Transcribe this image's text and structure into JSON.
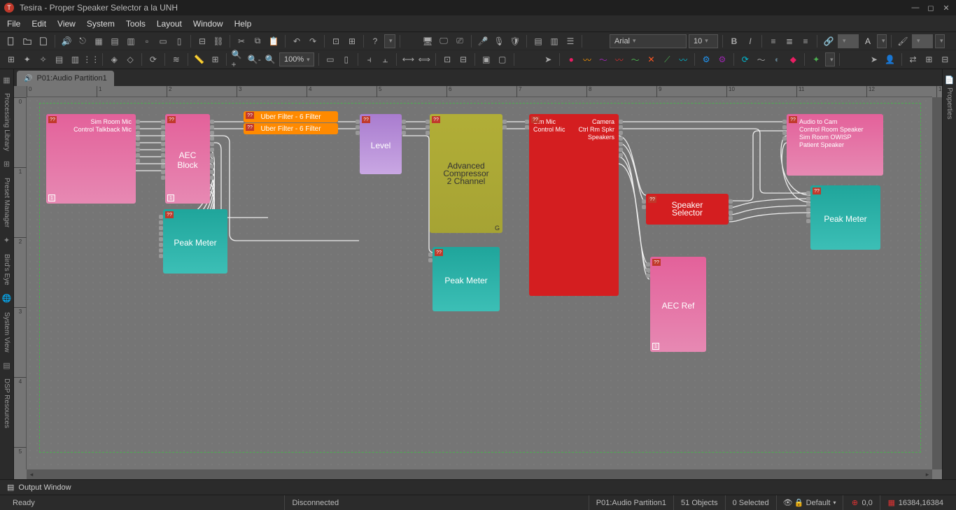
{
  "app": {
    "logo_letter": "T",
    "title": "Tesira - Proper Speaker Selector a la UNH"
  },
  "menu": [
    "File",
    "Edit",
    "View",
    "System",
    "Tools",
    "Layout",
    "Window",
    "Help"
  ],
  "toolbar": {
    "font_family": "Arial",
    "font_size": "10",
    "zoom": "100%"
  },
  "sidebar_left": [
    "Processing Library",
    "Preset Manager",
    "Bird's Eye",
    "System View",
    "DSP Resources"
  ],
  "sidebar_right": [
    "Properties"
  ],
  "tab": {
    "label": "P01:Audio Partition1"
  },
  "blocks": {
    "simroom": {
      "lines": [
        "Sim Room Mic",
        "Control Talkback Mic"
      ],
      "idx": "1"
    },
    "aec": {
      "label": "AEC Block",
      "idx": "1"
    },
    "uber1": {
      "label": "Uber Filter - 6 Filter"
    },
    "uber2": {
      "label": "Uber Filter - 6 Filter"
    },
    "level": {
      "label": "Level"
    },
    "comp": {
      "lines": [
        "Advanced",
        "Compressor",
        "2 Channel"
      ],
      "hint": "G"
    },
    "peak1": {
      "label": "Peak Meter"
    },
    "peak2": {
      "label": "Peak Meter"
    },
    "mux": {
      "left": [
        "Sim Mic",
        "Control Mic"
      ],
      "right": [
        "Camera",
        "Ctrl Rm Spkr",
        "Speakers"
      ]
    },
    "spsel": {
      "lines": [
        "Speaker",
        "Selector"
      ]
    },
    "aecref": {
      "label": "AEC Ref",
      "idx": "1"
    },
    "output": {
      "lines": [
        "Audio to Cam",
        "Control Room Speaker",
        "Sim Room OWISP",
        "Patient Speaker"
      ]
    },
    "peak3": {
      "label": "Peak Meter"
    }
  },
  "marker_text": "??",
  "output_window": "Output Window",
  "status": {
    "ready": "Ready",
    "conn": "Disconnected",
    "partition": "P01:Audio Partition1",
    "objects": "51 Objects",
    "selected": "0 Selected",
    "layer": "Default",
    "cursor": "0,0",
    "extent": "16384,16384"
  }
}
